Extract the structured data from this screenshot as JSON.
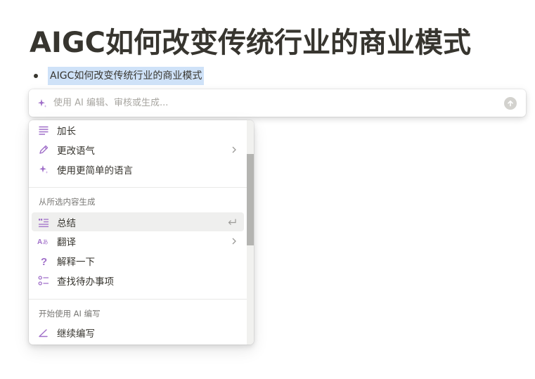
{
  "page": {
    "title": "AIGC如何改变传统行业的商业模式",
    "bullet_text": "AIGC如何改变传统行业的商业模式"
  },
  "ai_bar": {
    "placeholder": "使用 AI 编辑、审核或生成...",
    "spark_icon": "sparkle-icon",
    "submit_icon": "arrow-up-circle-icon"
  },
  "menu": {
    "items_top": [
      {
        "label": "加长",
        "icon": "lines-icon"
      },
      {
        "label": "更改语气",
        "icon": "pen-icon",
        "has_submenu": true
      },
      {
        "label": "使用更简单的语言",
        "icon": "sparkle-icon"
      }
    ],
    "section_generate": "从所选内容生成",
    "items_generate": [
      {
        "label": "总结",
        "icon": "quote-lines-icon",
        "active": true
      },
      {
        "label": "翻译",
        "icon": "translate-icon",
        "has_submenu": true
      },
      {
        "label": "解释一下",
        "icon": "question-icon"
      },
      {
        "label": "查找待办事项",
        "icon": "todo-list-icon"
      }
    ],
    "section_write": "开始使用 AI 编写",
    "items_write": [
      {
        "label": "继续编写",
        "icon": "continue-writing-icon"
      }
    ]
  },
  "colors": {
    "accent_purple": "#a06fc9",
    "highlight_blue": "#cfe2f8",
    "text": "#37352f"
  }
}
